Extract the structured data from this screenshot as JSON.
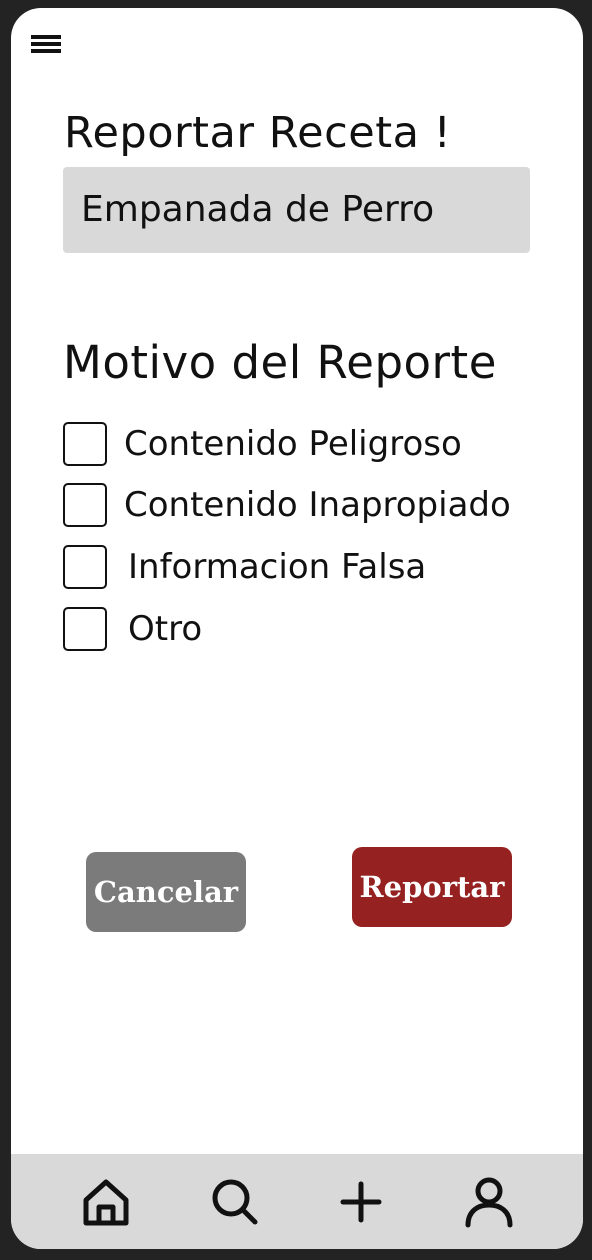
{
  "header": {
    "menu_icon": "hamburger-menu-icon"
  },
  "form": {
    "title": "Reportar Receta !",
    "recipe_name": "Empanada de Perro",
    "reason_title": "Motivo del Reporte",
    "options": [
      {
        "label": "Contenido Peligroso",
        "checked": false
      },
      {
        "label": "Contenido Inapropiado",
        "checked": false
      },
      {
        "label": "Informacion Falsa",
        "checked": false
      },
      {
        "label": "Otro",
        "checked": false
      }
    ]
  },
  "actions": {
    "cancel_label": "Cancelar",
    "report_label": "Reportar",
    "cancel_color": "#7b7b7b",
    "report_color": "#952220"
  },
  "bottom_nav": {
    "items": [
      {
        "icon": "home-icon"
      },
      {
        "icon": "search-icon"
      },
      {
        "icon": "plus-icon"
      },
      {
        "icon": "user-icon"
      }
    ]
  }
}
